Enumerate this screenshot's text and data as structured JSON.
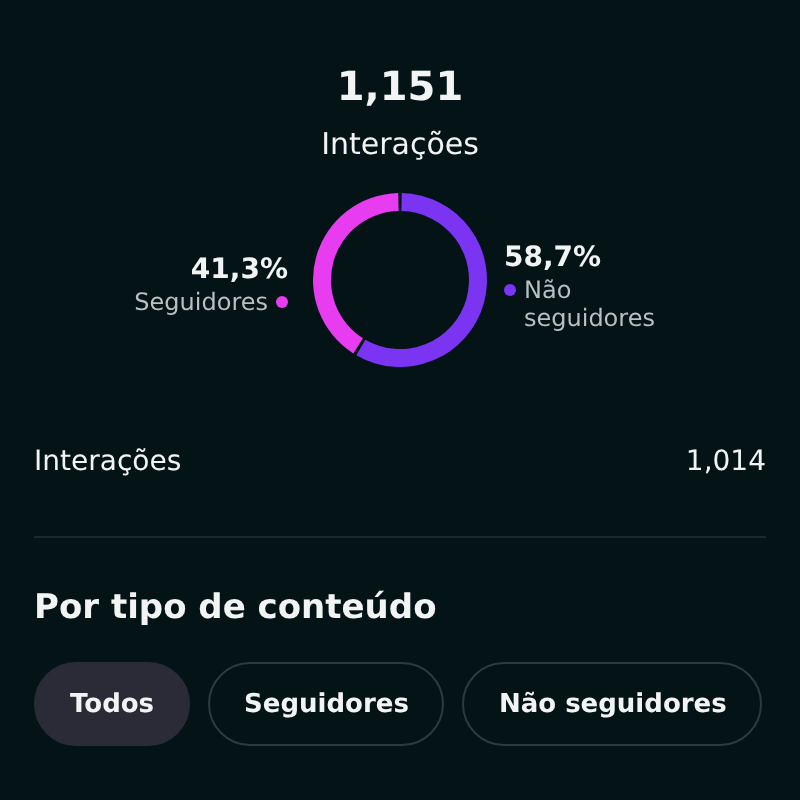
{
  "summary": {
    "total": "1,151",
    "label": "Interações"
  },
  "chart_data": {
    "type": "donut",
    "categories": [
      "Seguidores",
      "Não seguidores"
    ],
    "values": [
      41.3,
      58.7
    ]
  },
  "segments": [
    {
      "percent": "41,3%",
      "color": "#e83cf0"
    },
    {
      "percent": "58,7%",
      "color": "#7a34f2"
    }
  ],
  "metric": {
    "label": "Interações",
    "value": "1,014"
  },
  "section": {
    "title": "Por tipo de conteúdo"
  },
  "filters": [
    {
      "label": "Todos",
      "selected": true
    },
    {
      "label": "Seguidores",
      "selected": false
    },
    {
      "label": "Não seguidores",
      "selected": false
    }
  ]
}
